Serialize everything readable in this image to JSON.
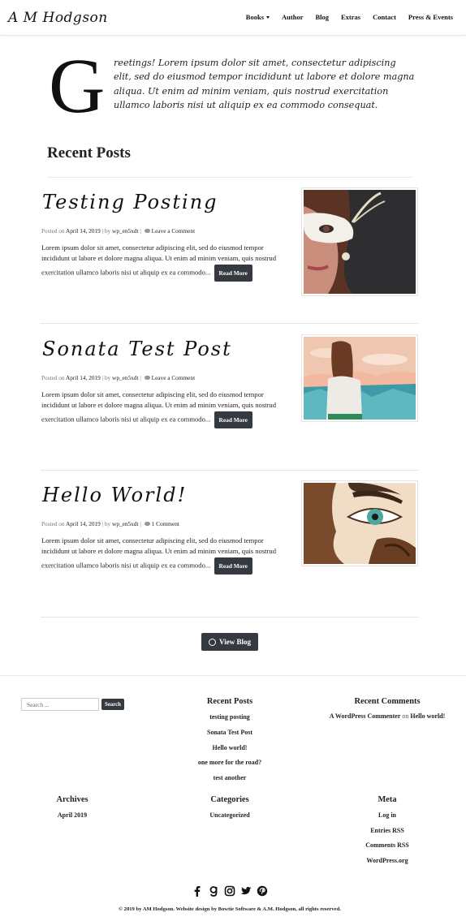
{
  "header": {
    "brand": "A M Hodgson",
    "nav": [
      {
        "label": "Books",
        "dropdown": true
      },
      {
        "label": "Author"
      },
      {
        "label": "Blog"
      },
      {
        "label": "Extras"
      },
      {
        "label": "Contact"
      },
      {
        "label": "Press & Events"
      }
    ]
  },
  "intro": {
    "dropcap": "G",
    "text": "reetings! Lorem ipsum dolor sit amet, consectetur adipiscing elit, sed do eiusmod tempor incididunt ut labore et dolore magna aliqua. Ut enim ad minim veniam, quis nostrud exercitation ullamco laboris nisi ut aliquip ex ea commodo consequat."
  },
  "recent_posts_title": "Recent Posts",
  "posts": [
    {
      "title": "Testing Posting",
      "posted_on": "Posted on",
      "date": "April 14, 2019",
      "by": "| by",
      "author": "wp_en5xdt",
      "sep": "|",
      "comments": "Leave a Comment",
      "excerpt": "Lorem ipsum dolor sit amet, consectetur adipiscing elit, sed do eiusmod tempor incididunt ut labore et dolore magna aliqua. Ut enim ad minim veniam, quis nostrud exercitation ullamco laboris nisi ut aliquip ex ea commodo...",
      "read_more": "Read More",
      "image": "masked-woman-painting"
    },
    {
      "title": "Sonata Test Post",
      "posted_on": "Posted on",
      "date": "April 14, 2019",
      "by": "| by",
      "author": "wp_en5xdt",
      "sep": "|",
      "comments": "Leave a Comment",
      "excerpt": "Lorem ipsum dolor sit amet, consectetur adipiscing elit, sed do eiusmod tempor incididunt ut labore et dolore magna aliqua. Ut enim ad minim veniam, quis nostrud exercitation ullamco laboris nisi ut aliquip ex ea commodo...",
      "read_more": "Read More",
      "image": "woman-sunset-painting"
    },
    {
      "title": "Hello World!",
      "posted_on": "Posted on",
      "date": "April 14, 2019",
      "by": "| by",
      "author": "wp_en5xdt",
      "sep": "|",
      "comments": "1 Comment",
      "excerpt": "Lorem ipsum dolor sit amet, consectetur adipiscing elit, sed do eiusmod tempor incididunt ut labore et dolore magna aliqua. Ut enim ad minim veniam, quis nostrud exercitation ullamco laboris nisi ut aliquip ex ea commodo...",
      "read_more": "Read More",
      "image": "eye-closeup-painting"
    }
  ],
  "view_blog": "View Blog",
  "footer": {
    "search_placeholder": "Search ...",
    "search_button": "Search",
    "recent_posts": {
      "title": "Recent Posts",
      "items": [
        "testing posting",
        "Sonata Test Post",
        "Hello world!",
        "one more for the road?",
        "test another"
      ]
    },
    "recent_comments": {
      "title": "Recent Comments",
      "author": "A WordPress Commenter",
      "on": "on",
      "post": "Hello world!"
    },
    "archives": {
      "title": "Archives",
      "items": [
        "April 2019"
      ]
    },
    "categories": {
      "title": "Categories",
      "items": [
        "Uncategorized"
      ]
    },
    "meta": {
      "title": "Meta",
      "items": [
        "Log in",
        "Entries RSS",
        "Comments RSS",
        "WordPress.org"
      ]
    },
    "socials": [
      "facebook-icon",
      "goodreads-icon",
      "instagram-icon",
      "twitter-icon",
      "pinterest-icon"
    ],
    "copyright": "© 2019 by AM Hodgson. Website design by Bowtie Software & A.M. Hodgson, all rights reserved."
  }
}
